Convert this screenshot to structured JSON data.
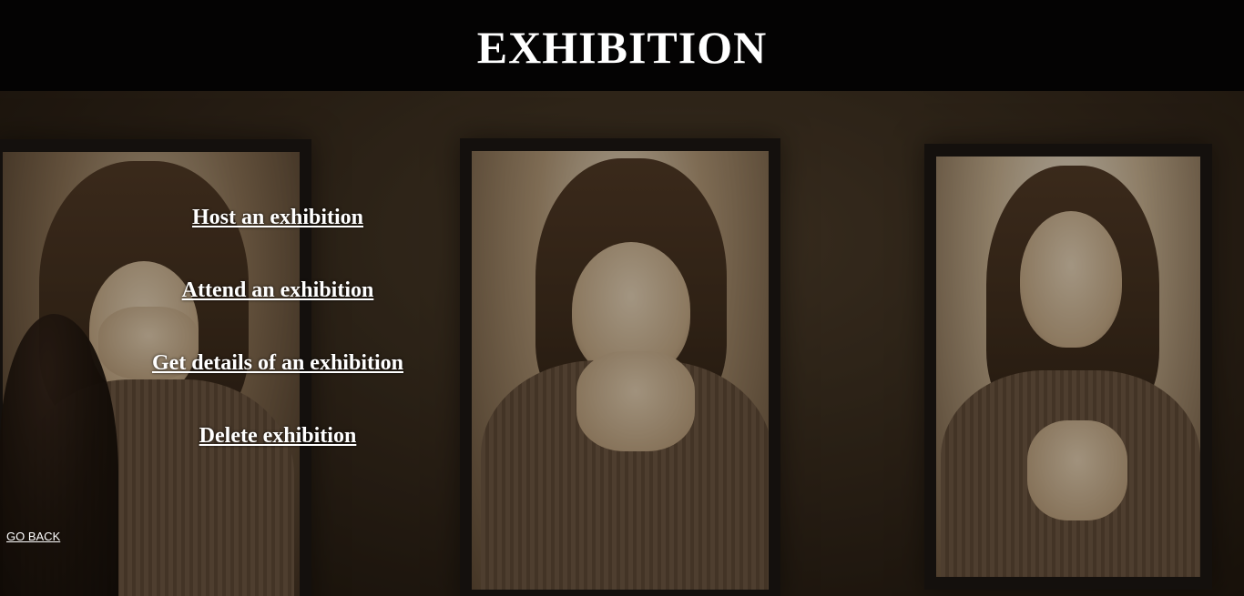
{
  "header": {
    "title": "EXHIBITION"
  },
  "menu": {
    "items": [
      {
        "label": "Host an exhibition"
      },
      {
        "label": "Attend an exhibition"
      },
      {
        "label": "Get details of  an exhibition"
      },
      {
        "label": "Delete exhibition"
      }
    ]
  },
  "nav": {
    "go_back_label": "GO BACK"
  },
  "background": {
    "description_icon": "framed-portraits-photo",
    "tone_colors": {
      "header": "#040303",
      "text": "#ffffff",
      "sepia": "#8a7358"
    }
  }
}
